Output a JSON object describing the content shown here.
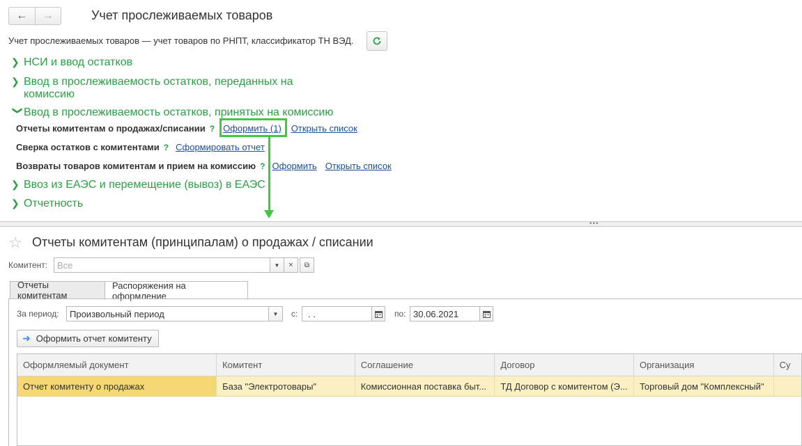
{
  "header": {
    "title": "Учет прослеживаемых товаров",
    "subtitle": "Учет прослеживаемых товаров — учет товаров по РНПТ, классификатор ТН ВЭД."
  },
  "sections": [
    {
      "label": "НСИ и ввод остатков",
      "expanded": false
    },
    {
      "label": "Ввод в прослеживаемость остатков, переданных на",
      "label2": "комиссию",
      "expanded": false
    },
    {
      "label": "Ввод в прослеживаемость остатков, принятых на комиссию",
      "expanded": true
    },
    {
      "label": "Ввоз из ЕАЭС и перемещение (вывоз) в ЕАЭС",
      "expanded": false
    },
    {
      "label": "Отчетность",
      "expanded": false
    }
  ],
  "rows": [
    {
      "label": "Отчеты комитентам о продажах/списании",
      "help": "?",
      "link1": "Оформить (1)",
      "link2": "Открыть список"
    },
    {
      "label": "Сверка остатков с комитентами",
      "help": "?",
      "link1": "Сформировать отчет"
    },
    {
      "label": "Возвраты товаров комитентам и прием на комиссию",
      "help": "?",
      "link1": "Оформить",
      "link2": "Открыть список"
    }
  ],
  "form": {
    "title": "Отчеты комитентам (принципалам) о продажах / списании",
    "komitent_label": "Комитент:",
    "komitent_placeholder": "Все",
    "tabs": [
      "Отчеты комитентам",
      "Распоряжения на оформление"
    ],
    "period_label": "За период:",
    "period_value": "Произвольный период",
    "from_label": "с:",
    "from_value": " .  .",
    "to_label": "по:",
    "to_value": "30.06.2021",
    "action_button": "Оформить отчет комитенту"
  },
  "table": {
    "columns": [
      "Оформляемый документ",
      "Комитент",
      "Соглашение",
      "Договор",
      "Организация",
      "Су"
    ],
    "rows": [
      [
        "Отчет комитенту о продажах",
        "База \"Электротовары\"",
        "Комиссионная поставка быт...",
        "ТД Договор с комитентом (Э...",
        "Торговый дом \"Комплексный\"",
        ""
      ]
    ]
  },
  "colors": {
    "accent_green": "#2c9f45",
    "link_blue": "#1a4f9c",
    "highlight": "#3fc93f",
    "row_selected": "#f6d776"
  }
}
